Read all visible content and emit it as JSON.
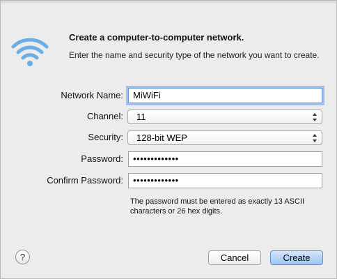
{
  "dialog": {
    "title": "Create a computer-to-computer network.",
    "description": "Enter the name and security type of the network you want to create."
  },
  "form": {
    "network_name": {
      "label": "Network Name:",
      "value": "MiWiFi"
    },
    "channel": {
      "label": "Channel:",
      "value": "11"
    },
    "security": {
      "label": "Security:",
      "value": "128-bit WEP"
    },
    "password": {
      "label": "Password:",
      "value": "•••••••••••••"
    },
    "confirm_password": {
      "label": "Confirm Password:",
      "value": "•••••••••••••"
    },
    "hint": "The password must be entered as exactly 13 ASCII characters or 26 hex digits."
  },
  "buttons": {
    "help": "?",
    "cancel": "Cancel",
    "create": "Create"
  },
  "icons": {
    "wifi": "wifi-icon",
    "help": "question-mark-icon",
    "stepper": "updown-arrows-icon"
  },
  "colors": {
    "wifi_blue": "#6aaee8",
    "focus_ring": "#9fc0ea",
    "default_button": "#9ec4f2"
  }
}
